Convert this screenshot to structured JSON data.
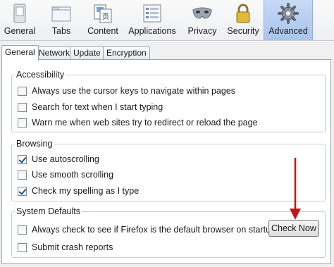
{
  "toolbar": {
    "panes": [
      {
        "label": "General",
        "icon": "general-switch-icon"
      },
      {
        "label": "Tabs",
        "icon": "tabs-window-icon"
      },
      {
        "label": "Content",
        "icon": "content-documents-icon"
      },
      {
        "label": "Applications",
        "icon": "applications-list-icon"
      },
      {
        "label": "Privacy",
        "icon": "privacy-mask-icon"
      },
      {
        "label": "Security",
        "icon": "security-padlock-icon"
      },
      {
        "label": "Advanced",
        "icon": "advanced-gear-icon",
        "selected": true
      }
    ]
  },
  "tabs": [
    {
      "label": "General",
      "selected": true
    },
    {
      "label": "Network"
    },
    {
      "label": "Update"
    },
    {
      "label": "Encryption"
    }
  ],
  "accessibility": {
    "title": "Accessibility",
    "items": [
      {
        "label": "Always use the cursor keys to navigate within pages",
        "checked": false
      },
      {
        "label": "Search for text when I start typing",
        "checked": false
      },
      {
        "label": "Warn me when web sites try to redirect or reload the page",
        "checked": false
      }
    ]
  },
  "browsing": {
    "title": "Browsing",
    "items": [
      {
        "label": "Use autoscrolling",
        "checked": true
      },
      {
        "label": "Use smooth scrolling",
        "checked": false
      },
      {
        "label": "Check my spelling as I type",
        "checked": true
      }
    ]
  },
  "system_defaults": {
    "title": "System Defaults",
    "items": [
      {
        "label": "Always check to see if Firefox is the default browser on startup",
        "checked": false
      },
      {
        "label": "Submit crash reports",
        "checked": false
      }
    ],
    "check_now_label": "Check Now"
  },
  "colors": {
    "selected_pane": "#b3cbf0",
    "arrow": "#c0161b"
  }
}
